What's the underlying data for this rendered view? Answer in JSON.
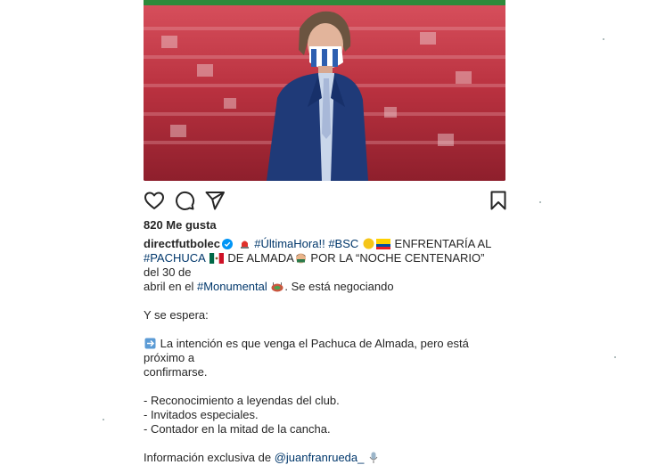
{
  "post": {
    "likes_text": "820 Me gusta",
    "username": "directfutbolec",
    "caption": {
      "l1_tag_hora": "#ÚltimaHora!!",
      "l1_tag_bsc": "#BSC",
      "l1_text": "ENFRENTARÍA AL",
      "l2_tag_pachuca": "#PACHUCA",
      "l2_text_a": "DE ALMADA",
      "l2_text_b": "POR LA “NOCHE CENTENARIO” del 30 de",
      "l3_text_a": "abril en el",
      "l3_tag_monumental": "#Monumental",
      "l3_text_b": ". Se está negociando",
      "se_espera": "Y se espera:",
      "intencion_l1": "La intención es que venga el Pachuca de Almada, pero está próximo a",
      "intencion_l2": "confirmarse.",
      "item1": "- Reconocimiento a leyendas del club.",
      "item2": "- Invitados especiales.",
      "item3": "- Contador en la mitad de la cancha.",
      "info_text": "Información exclusiva de",
      "info_mention": "@juanfranrueda_"
    }
  },
  "icons": {
    "like": "heart-icon",
    "comment": "comment-icon",
    "share": "paper-plane-icon",
    "save": "bookmark-icon",
    "verified": "verified-badge-icon"
  },
  "colors": {
    "link": "#00376b",
    "text": "#262626",
    "verified": "#0095f6"
  }
}
